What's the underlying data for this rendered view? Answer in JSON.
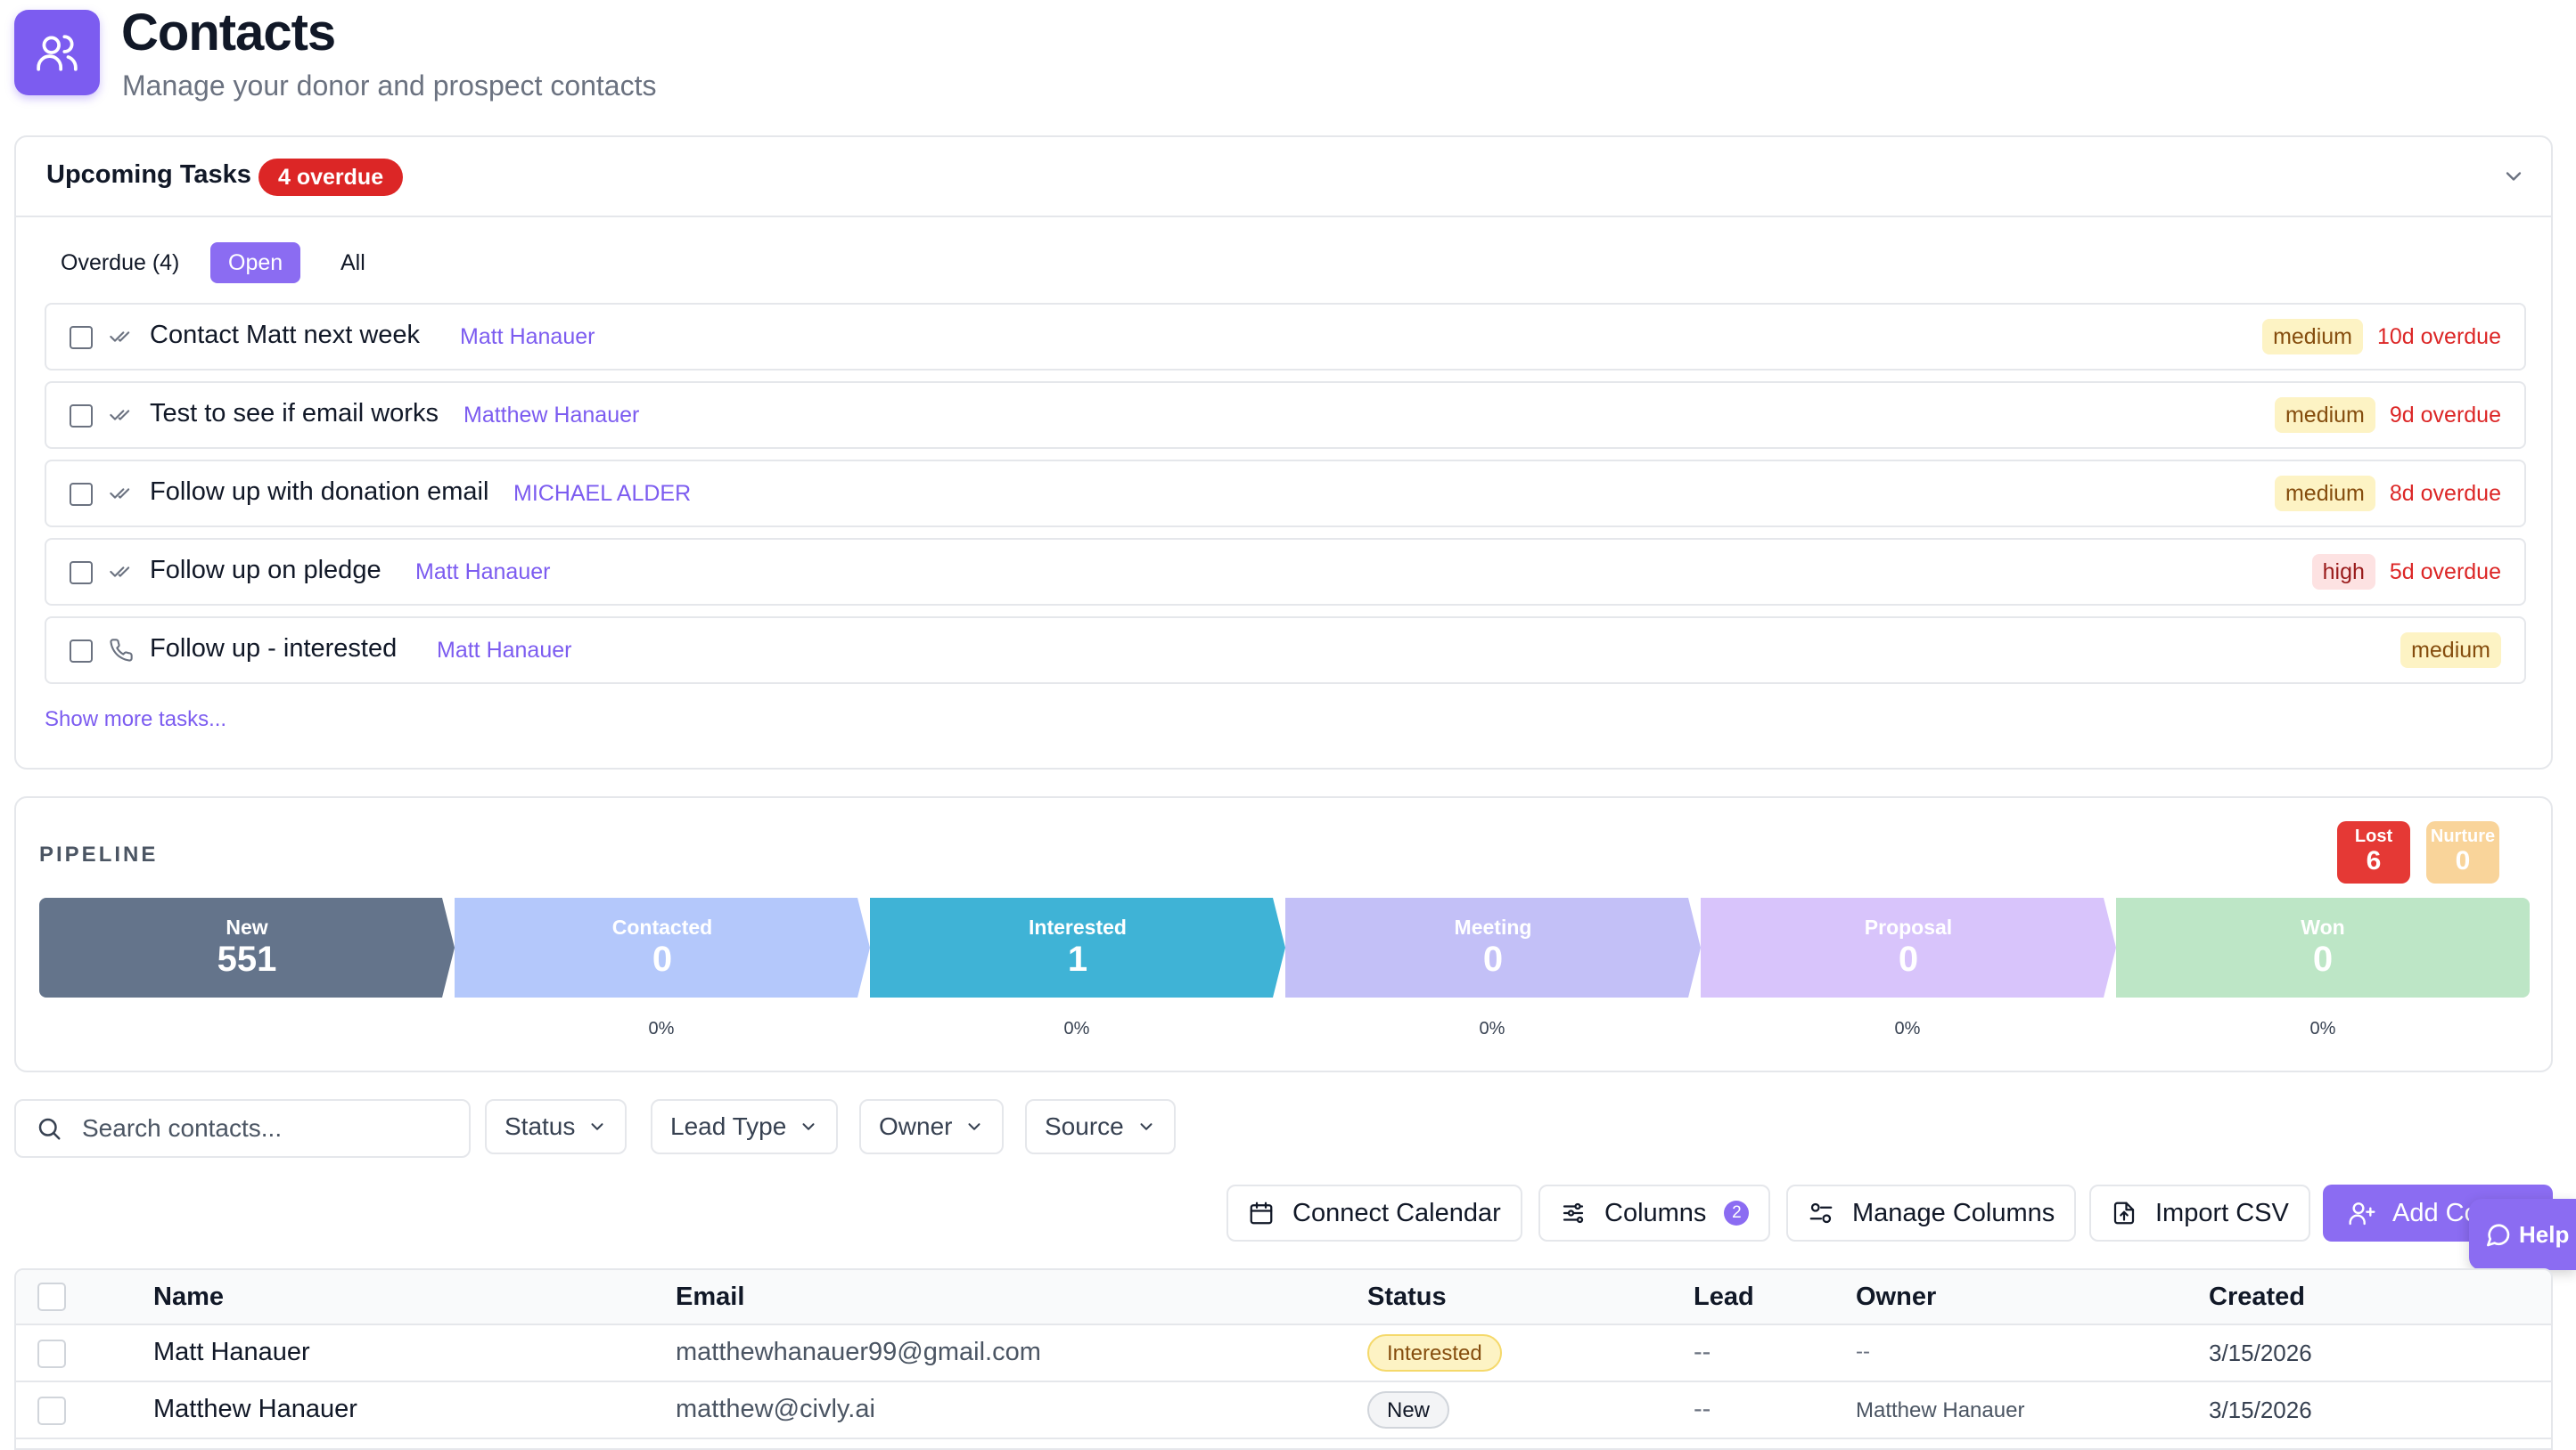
{
  "header": {
    "title": "Contacts",
    "subtitle": "Manage your donor and prospect contacts",
    "icon": "users-icon"
  },
  "tasks": {
    "title": "Upcoming Tasks",
    "overdue_badge": "4 overdue",
    "filters": [
      {
        "label": "Overdue (4)",
        "active": false
      },
      {
        "label": "Open",
        "active": true
      },
      {
        "label": "All",
        "active": false
      }
    ],
    "items": [
      {
        "icon": "double-check-icon",
        "title": "Contact Matt next week",
        "contact": "Matt Hanauer",
        "priority": "medium",
        "due": "10d overdue"
      },
      {
        "icon": "double-check-icon",
        "title": "Test to see if email works",
        "contact": "Matthew Hanauer",
        "priority": "medium",
        "due": "9d overdue"
      },
      {
        "icon": "double-check-icon",
        "title": "Follow up with donation email",
        "contact": "MICHAEL ALDER",
        "priority": "medium",
        "due": "8d overdue"
      },
      {
        "icon": "double-check-icon",
        "title": "Follow up on pledge",
        "contact": "Matt Hanauer",
        "priority": "high",
        "due": "5d overdue"
      },
      {
        "icon": "phone-icon",
        "title": "Follow up - interested",
        "contact": "Matt Hanauer",
        "priority": "medium",
        "due": ""
      }
    ],
    "show_more": "Show more tasks..."
  },
  "pipeline": {
    "label": "PIPELINE",
    "side": [
      {
        "label": "Lost",
        "value": "6",
        "color": "#e53935"
      },
      {
        "label": "Nurture",
        "value": "0",
        "color": "#f9d49a"
      }
    ],
    "stages": [
      {
        "label": "New",
        "value": "551",
        "pct": "",
        "color": "#64748b"
      },
      {
        "label": "Contacted",
        "value": "0",
        "pct": "0%",
        "color": "#b4c8fb"
      },
      {
        "label": "Interested",
        "value": "1",
        "pct": "0%",
        "color": "#3fb3d6"
      },
      {
        "label": "Meeting",
        "value": "0",
        "pct": "0%",
        "color": "#c3c0f7"
      },
      {
        "label": "Proposal",
        "value": "0",
        "pct": "0%",
        "color": "#d8c4fb"
      },
      {
        "label": "Won",
        "value": "0",
        "pct": "0%",
        "color": "#bde6c6"
      }
    ]
  },
  "search": {
    "placeholder": "Search contacts..."
  },
  "filters": [
    "Status",
    "Lead Type",
    "Owner",
    "Source"
  ],
  "toolbar": {
    "connect_calendar": "Connect Calendar",
    "columns": "Columns",
    "columns_count": "2",
    "manage_columns": "Manage Columns",
    "import_csv": "Import CSV",
    "add_contact": "Add Co",
    "help": "Help"
  },
  "table": {
    "columns": [
      "Name",
      "Email",
      "Status",
      "Lead",
      "Owner",
      "Created"
    ],
    "rows": [
      {
        "name": "Matt Hanauer",
        "email": "matthewhanauer99@gmail.com",
        "status": "Interested",
        "lead": "--",
        "owner": "--",
        "created": "3/15/2026"
      },
      {
        "name": "Matthew Hanauer",
        "email": "matthew@civly.ai",
        "status": "New",
        "lead": "--",
        "owner": "Matthew Hanauer",
        "created": "3/15/2026"
      }
    ]
  }
}
